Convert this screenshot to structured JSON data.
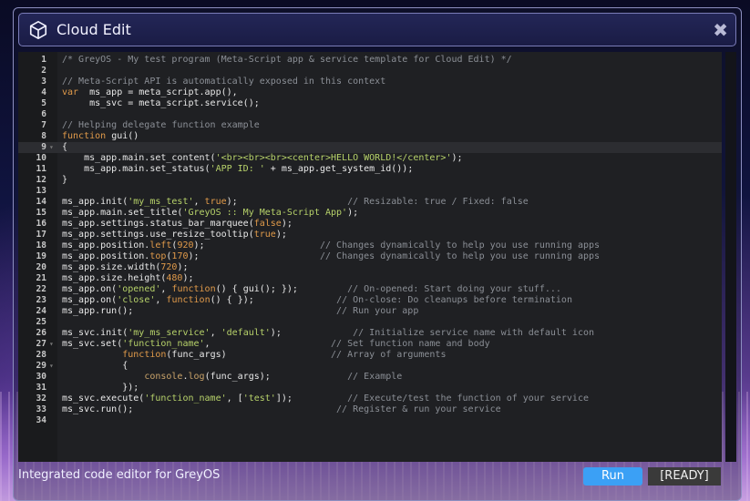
{
  "window": {
    "title": "Cloud Edit",
    "close_symbol": "✖",
    "title_icon": "cube-icon",
    "close_icon": "close-icon"
  },
  "editor": {
    "active_line": 9,
    "lines": [
      {
        "n": "1",
        "fold": "",
        "segs": [
          [
            "c",
            "/* GreyOS - My test program (Meta-Script app & service template for Cloud Edit) */"
          ]
        ]
      },
      {
        "n": "2",
        "fold": "",
        "segs": []
      },
      {
        "n": "3",
        "fold": "",
        "segs": [
          [
            "c",
            "// Meta-Script API is automatically exposed in this context"
          ]
        ]
      },
      {
        "n": "4",
        "fold": "",
        "segs": [
          [
            "k",
            "var"
          ],
          [
            "",
            "  ms_app = meta_script.app(),"
          ]
        ]
      },
      {
        "n": "5",
        "fold": "",
        "segs": [
          [
            "",
            "     ms_svc = meta_script.service();"
          ]
        ]
      },
      {
        "n": "6",
        "fold": "",
        "segs": []
      },
      {
        "n": "7",
        "fold": "",
        "segs": [
          [
            "c",
            "// Helping delegate function example"
          ]
        ]
      },
      {
        "n": "8",
        "fold": "",
        "segs": [
          [
            "k",
            "function"
          ],
          [
            "",
            " gui()"
          ]
        ]
      },
      {
        "n": "9",
        "fold": "▾",
        "segs": [
          [
            "",
            "{"
          ]
        ]
      },
      {
        "n": "10",
        "fold": "",
        "segs": [
          [
            "",
            "    ms_app.main.set_content("
          ],
          [
            "s",
            "'<br><br><br><center>HELLO WORLD!</center>'"
          ],
          [
            "",
            ");"
          ]
        ]
      },
      {
        "n": "11",
        "fold": "",
        "segs": [
          [
            "",
            "    ms_app.main.set_status("
          ],
          [
            "s",
            "'APP ID: '"
          ],
          [
            "",
            " + ms_app.get_system_id());"
          ]
        ]
      },
      {
        "n": "12",
        "fold": "",
        "segs": [
          [
            "",
            "}"
          ]
        ]
      },
      {
        "n": "13",
        "fold": "",
        "segs": []
      },
      {
        "n": "14",
        "fold": "",
        "segs": [
          [
            "",
            "ms_app.init("
          ],
          [
            "s",
            "'my_ms_test'"
          ],
          [
            "",
            ", "
          ],
          [
            "k",
            "true"
          ],
          [
            "",
            ");                    "
          ],
          [
            "c",
            "// Resizable: true / Fixed: false"
          ]
        ]
      },
      {
        "n": "15",
        "fold": "",
        "segs": [
          [
            "",
            "ms_app.main.set_title("
          ],
          [
            "s",
            "'GreyOS :: My Meta-Script App'"
          ],
          [
            "",
            ");"
          ]
        ]
      },
      {
        "n": "16",
        "fold": "",
        "segs": [
          [
            "",
            "ms_app.settings.status_bar_marquee("
          ],
          [
            "k",
            "false"
          ],
          [
            "",
            ");"
          ]
        ]
      },
      {
        "n": "17",
        "fold": "",
        "segs": [
          [
            "",
            "ms_app.settings.use_resize_tooltip("
          ],
          [
            "k",
            "true"
          ],
          [
            "",
            ");"
          ]
        ]
      },
      {
        "n": "18",
        "fold": "",
        "segs": [
          [
            "",
            "ms_app.position."
          ],
          [
            "k",
            "left"
          ],
          [
            "",
            "("
          ],
          [
            "n",
            "920"
          ],
          [
            "",
            ");                     "
          ],
          [
            "c",
            "// Changes dynamically to help you use running apps"
          ]
        ]
      },
      {
        "n": "19",
        "fold": "",
        "segs": [
          [
            "",
            "ms_app.position."
          ],
          [
            "k",
            "top"
          ],
          [
            "",
            "("
          ],
          [
            "n",
            "170"
          ],
          [
            "",
            ");                      "
          ],
          [
            "c",
            "// Changes dynamically to help you use running apps"
          ]
        ]
      },
      {
        "n": "20",
        "fold": "",
        "segs": [
          [
            "",
            "ms_app.size.width("
          ],
          [
            "n",
            "720"
          ],
          [
            "",
            ");"
          ]
        ]
      },
      {
        "n": "21",
        "fold": "",
        "segs": [
          [
            "",
            "ms_app.size.height("
          ],
          [
            "n",
            "480"
          ],
          [
            "",
            ");"
          ]
        ]
      },
      {
        "n": "22",
        "fold": "",
        "segs": [
          [
            "",
            "ms_app.on("
          ],
          [
            "s",
            "'opened'"
          ],
          [
            "",
            ", "
          ],
          [
            "k",
            "function"
          ],
          [
            "",
            "() { gui(); });         "
          ],
          [
            "c",
            "// On-opened: Start doing your stuff..."
          ]
        ]
      },
      {
        "n": "23",
        "fold": "",
        "segs": [
          [
            "",
            "ms_app.on("
          ],
          [
            "s",
            "'close'"
          ],
          [
            "",
            ", "
          ],
          [
            "k",
            "function"
          ],
          [
            "",
            "() { });               "
          ],
          [
            "c",
            "// On-close: Do cleanups before termination"
          ]
        ]
      },
      {
        "n": "24",
        "fold": "",
        "segs": [
          [
            "",
            "ms_app.run();                                     "
          ],
          [
            "c",
            "// Run your app"
          ]
        ]
      },
      {
        "n": "25",
        "fold": "",
        "segs": []
      },
      {
        "n": "26",
        "fold": "",
        "segs": [
          [
            "",
            "ms_svc.init("
          ],
          [
            "s",
            "'my_ms_service'"
          ],
          [
            "",
            ", "
          ],
          [
            "s",
            "'default'"
          ],
          [
            "",
            ");             "
          ],
          [
            "c",
            "// Initialize service name with default icon"
          ]
        ]
      },
      {
        "n": "27",
        "fold": "▾",
        "segs": [
          [
            "",
            "ms_svc.set("
          ],
          [
            "s",
            "'function_name'"
          ],
          [
            "",
            ",                      "
          ],
          [
            "c",
            "// Set function name and body"
          ]
        ]
      },
      {
        "n": "28",
        "fold": "",
        "segs": [
          [
            "",
            "           "
          ],
          [
            "k",
            "function"
          ],
          [
            "",
            "(func_args)                   "
          ],
          [
            "c",
            "// Array of arguments"
          ]
        ]
      },
      {
        "n": "29",
        "fold": "▾",
        "segs": [
          [
            "",
            "           {"
          ]
        ]
      },
      {
        "n": "30",
        "fold": "",
        "segs": [
          [
            "",
            "               "
          ],
          [
            "fn",
            "console"
          ],
          [
            "",
            "."
          ],
          [
            "fn",
            "log"
          ],
          [
            "",
            "(func_args);              "
          ],
          [
            "c",
            "// Example"
          ]
        ]
      },
      {
        "n": "31",
        "fold": "",
        "segs": [
          [
            "",
            "           });"
          ]
        ]
      },
      {
        "n": "32",
        "fold": "",
        "segs": [
          [
            "",
            "ms_svc.execute("
          ],
          [
            "s",
            "'function_name'"
          ],
          [
            "",
            ", ["
          ],
          [
            "s",
            "'test'"
          ],
          [
            "",
            "]);          "
          ],
          [
            "c",
            "// Execute/test the function of your service"
          ]
        ]
      },
      {
        "n": "33",
        "fold": "",
        "segs": [
          [
            "",
            "ms_svc.run();                                     "
          ],
          [
            "c",
            "// Register & run your service"
          ]
        ]
      },
      {
        "n": "34",
        "fold": "",
        "segs": []
      }
    ]
  },
  "footer": {
    "status_text": "Integrated code editor for GreyOS",
    "run_label": "Run",
    "ready_label": "[READY]"
  }
}
